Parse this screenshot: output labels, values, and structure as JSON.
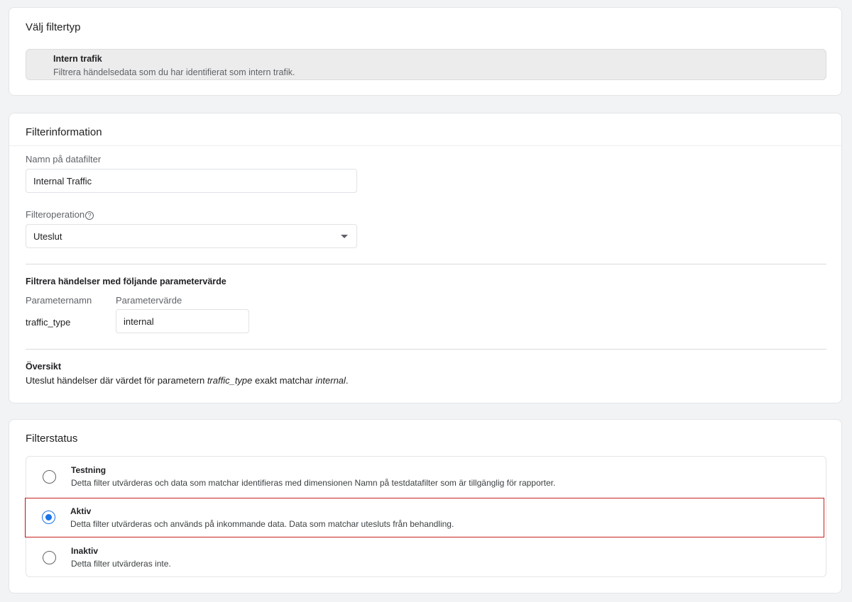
{
  "filter_type_card": {
    "title": "Välj filtertyp",
    "option": {
      "name": "Intern trafik",
      "description": "Filtrera händelsedata som du har identifierat som intern trafik."
    }
  },
  "filter_info_card": {
    "title": "Filterinformation",
    "name_label": "Namn på datafilter",
    "name_value": "Internal Traffic",
    "operation_label": "Filteroperation",
    "operation_help_icon": "?",
    "operation_value": "Uteslut",
    "param_section_heading": "Filtrera händelser med följande parametervärde",
    "param_name_header": "Parameternamn",
    "param_value_header": "Parametervärde",
    "param_name": "traffic_type",
    "param_value": "internal",
    "overview_heading": "Översikt",
    "overview": {
      "prefix": "Uteslut händelser där värdet för parametern ",
      "param": "traffic_type",
      "middle": " exakt matchar ",
      "value": "internal",
      "suffix": "."
    }
  },
  "filter_status_card": {
    "title": "Filterstatus",
    "selected": "Aktiv",
    "options": [
      {
        "title": "Testning",
        "description": "Detta filter utvärderas och data som matchar identifieras med dimensionen Namn på testdatafilter som är tillgänglig för rapporter."
      },
      {
        "title": "Aktiv",
        "description": "Detta filter utvärderas och används på inkommande data. Data som matchar utesluts från behandling."
      },
      {
        "title": "Inaktiv",
        "description": "Detta filter utvärderas inte."
      }
    ]
  },
  "colors": {
    "accent": "#1a73e8",
    "highlight_border": "#c5221f",
    "background": "#f1f3f4"
  }
}
